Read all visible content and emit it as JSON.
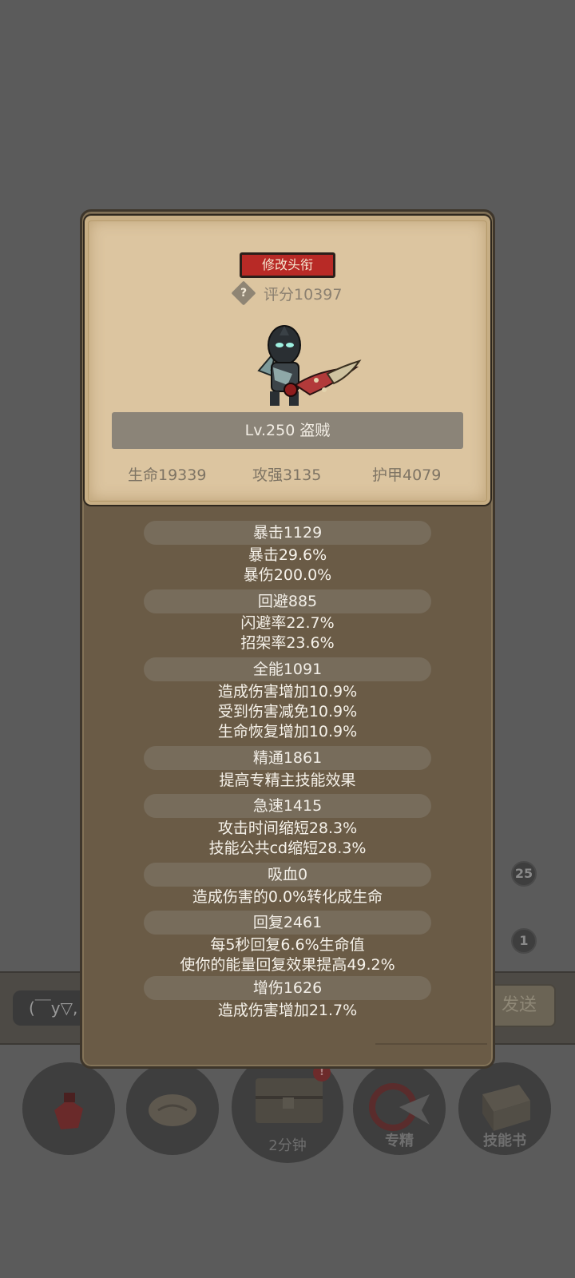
{
  "background": {
    "chat_placeholder": "(￣y▽,",
    "send_label": "发送",
    "badges": [
      "25",
      "1"
    ],
    "bottom_nav": {
      "chest_timer": "2分钟",
      "specialization_label": "专精",
      "skill_book_label": "技能书"
    }
  },
  "profile": {
    "change_title_button": "修改头衔",
    "score_help_icon": "?",
    "score": "评分10397",
    "level_class": "Lv.250 盗贼",
    "base_stats": {
      "hp": "生命19339",
      "attack": "攻强3135",
      "armor": "护甲4079"
    }
  },
  "stats": [
    {
      "header": "暴击1129",
      "lines": [
        "暴击29.6%",
        "暴伤200.0%"
      ]
    },
    {
      "header": "回避885",
      "lines": [
        "闪避率22.7%",
        "招架率23.6%"
      ]
    },
    {
      "header": "全能1091",
      "lines": [
        "造成伤害增加10.9%",
        "受到伤害减免10.9%",
        "生命恢复增加10.9%"
      ]
    },
    {
      "header": "精通1861",
      "lines": [
        "提高专精主技能效果"
      ]
    },
    {
      "header": "急速1415",
      "lines": [
        "攻击时间缩短28.3%",
        "技能公共cd缩短28.3%"
      ]
    },
    {
      "header": "吸血0",
      "lines": [
        "造成伤害的0.0%转化成生命"
      ]
    },
    {
      "header": "回复2461",
      "lines": [
        "每5秒回复6.6%生命值",
        "使你的能量回复效果提高49.2%"
      ]
    },
    {
      "header": "增伤1626",
      "lines": [
        "造成伤害增加21.7%"
      ]
    }
  ],
  "colors": {
    "overlay_bg": "#5b5b5b",
    "panel_brown": "#6a5b46",
    "parchment": "#dcc5a0",
    "title_red": "#b82a26"
  }
}
